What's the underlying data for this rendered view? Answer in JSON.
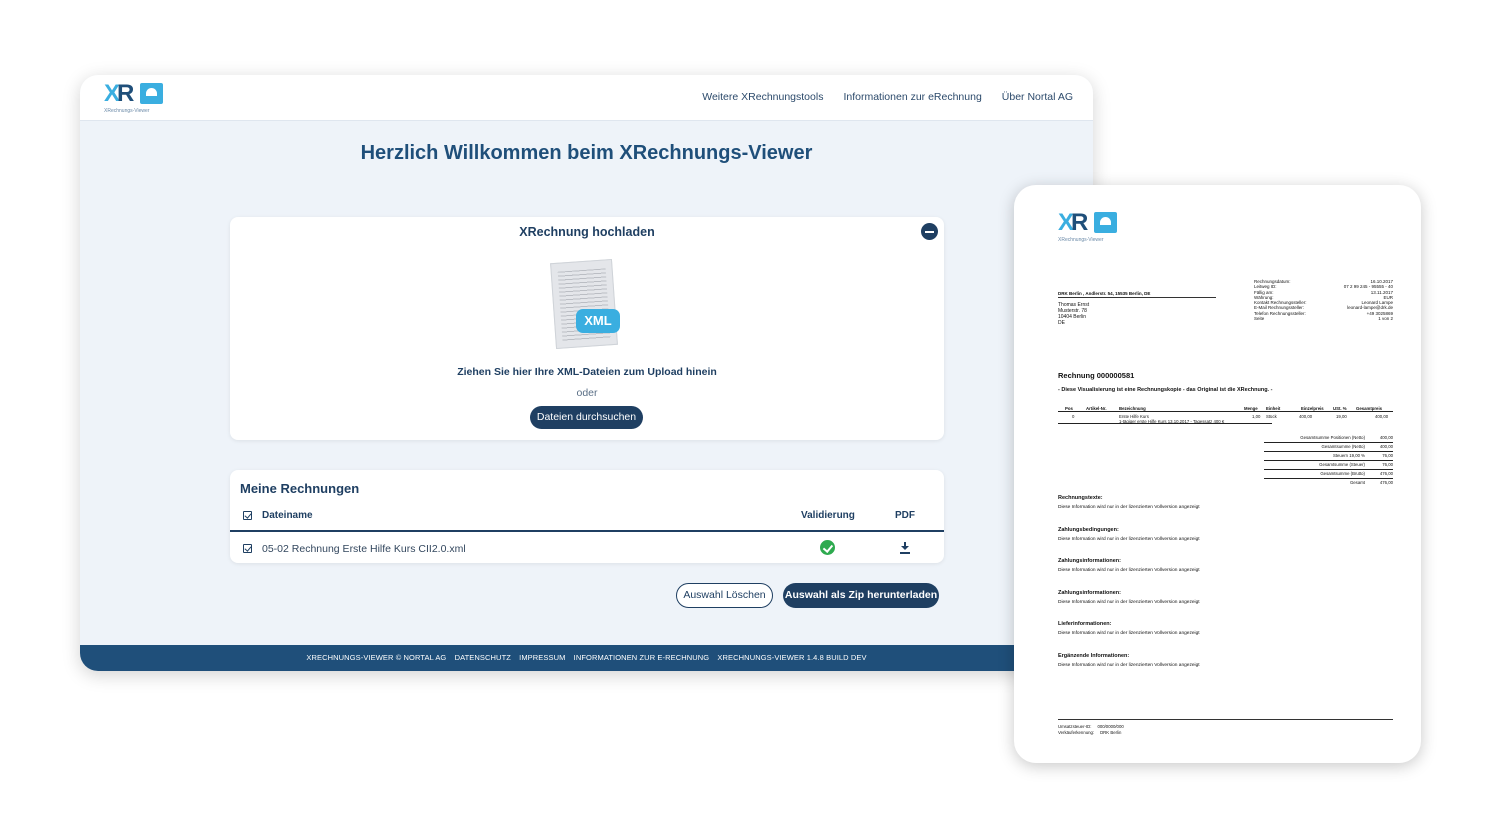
{
  "header": {
    "logo_subtitle": "XRechnungs-Viewer",
    "nav": [
      "Weitere XRechnungstools",
      "Informationen zur eRechnung",
      "Über Nortal AG"
    ]
  },
  "welcome_title": "Herzlich Willkommen beim XRechnungs-Viewer",
  "upload": {
    "title": "XRechnung hochladen",
    "badge": "XML",
    "drop_text": "Ziehen Sie hier Ihre XML-Dateien zum Upload hinein",
    "or": "oder",
    "browse_label": "Dateien durchsuchen"
  },
  "invoices": {
    "title": "Meine Rechnungen",
    "columns": {
      "name": "Dateiname",
      "validation": "Validierung",
      "pdf": "PDF"
    },
    "rows": [
      {
        "name": "05-02 Rechnung Erste Hilfe Kurs CII2.0.xml",
        "valid": true,
        "checked": true
      }
    ]
  },
  "actions": {
    "clear": "Auswahl Löschen",
    "zip": "Auswahl als Zip herunterladen"
  },
  "footer": [
    "XRECHNUNGS-VIEWER © NORTAL AG",
    "DATENSCHUTZ",
    "IMPRESSUM",
    "INFORMATIONEN ZUR E-RECHNUNG",
    "XRECHNUNGS-VIEWER 1.4.8 BUILD DEV"
  ],
  "invoice_doc": {
    "logo_subtitle": "XRechnungs-Viewer",
    "sender_line": "DRK Berlin , Andlerstr. 54, 15535 Berlin, DE",
    "recipient": [
      "Thomas Ernst",
      "Musterstr. 78",
      "10404 Berlin",
      "DE"
    ],
    "meta": [
      [
        "Rechnungsdatum:",
        "16.10.2017"
      ],
      [
        "Leitweg ID:",
        "07 2 99 245 - 95555 - 40"
      ],
      [
        "Fällig am:",
        "13.11.2017"
      ],
      [
        "Währung:",
        "EUR"
      ],
      [
        "Kontakt Rechnungssteller:",
        "Leonard Lampe"
      ],
      [
        "E-Mail Rechnungssteller:",
        "leonard-lampe@drk.de"
      ],
      [
        "Telefon Rechnungssteller:",
        "+49 3025869"
      ],
      [
        "Seite",
        "1 von 2"
      ]
    ],
    "title": "Rechnung 000000581",
    "note": "- Diese Visualisierung ist eine Rechnungskopie - das Original ist die XRechnung. -",
    "table_head": [
      "Pos",
      "Artikel-Nr.",
      "Bezeichnung",
      "Menge",
      "Einheit",
      "Einzelpreis",
      "USt. %",
      "Gesamtpreis"
    ],
    "item": {
      "pos": "0",
      "desc": "Erste Hilfe Kurs",
      "desc_sub": "1-tägiger erste Hilfe Kurs 13.10.2017 - Tagessatz 400 €",
      "qty": "1,00",
      "unit": "Stück",
      "price": "400,00",
      "vat": "19,00",
      "total": "400,00"
    },
    "totals": [
      [
        "Gesamtsumme Positionen (Netto)",
        "400,00"
      ],
      [
        "Gesamtsumme (Netto)",
        "400,00"
      ],
      [
        "Steuern 19,00 %",
        "76,00"
      ],
      [
        "Gesamtsumme (Steuer)",
        "76,00"
      ],
      [
        "Gesamtsumme (Brutto)",
        "476,00"
      ],
      [
        "Gesamt",
        "476,00"
      ]
    ],
    "sections": [
      {
        "heading": "Rechnungstexte:",
        "text": "Diese Information wird nur in der lizenzierten Vollversion angezeigt"
      },
      {
        "heading": "Zahlungsbedingungen:",
        "text": "Diese Information wird nur in der lizenzierten Vollversion angezeigt"
      },
      {
        "heading": "Zahlungsinformationen:",
        "text": "Diese Information wird nur in der lizenzierten Vollversion angezeigt"
      },
      {
        "heading": "Zahlungsinformationen:",
        "text": "Diese Information wird nur in der lizenzierten Vollversion angezeigt"
      },
      {
        "heading": "Lieferinformationen:",
        "text": "Diese Information wird nur in der lizenzierten Vollversion angezeigt"
      },
      {
        "heading": "Ergänzende Informationen:",
        "text": "Diese Information wird nur in der lizenzierten Vollversion angezeigt"
      }
    ],
    "footer": [
      [
        "Umsatzsteuer-ID:",
        "000/0000/000"
      ],
      [
        "Verkäuferkennung:",
        "DRK Berlin"
      ]
    ]
  }
}
